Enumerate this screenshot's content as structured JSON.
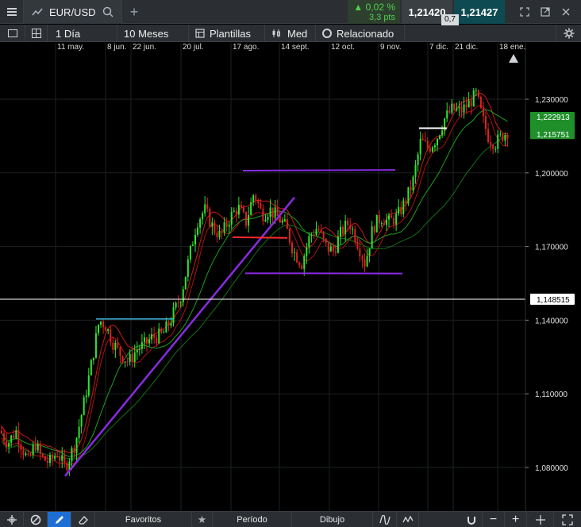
{
  "topbar": {
    "symbol": "EUR/USD",
    "add_tab": "+",
    "change_pct": "▲ 0,02 %",
    "change_pts": "3,3 pts",
    "bid": "1,21420",
    "ask": "1,21427",
    "spread": "0,7"
  },
  "toolbar": {
    "interval": "1 Día",
    "range": "10 Meses",
    "templates": "Plantillas",
    "style": "Med",
    "related": "Relacionado"
  },
  "chart_data": {
    "type": "candlestick",
    "symbol": "EUR/USD",
    "x_tick_labels": [
      "11 may.",
      "8 jun.",
      "22 jun.",
      "20 jul.",
      "17 ago.",
      "14 sept.",
      "12 oct.",
      "9 nov.",
      "7 dic.",
      "21 dic.",
      "18 ene."
    ],
    "y_tick_labels": [
      "1,230000",
      "1,200000",
      "1,170000",
      "1,140000",
      "1,110000",
      "1,080000"
    ],
    "y_ticks": [
      1.23,
      1.2,
      1.17,
      1.14,
      1.11,
      1.08
    ],
    "ylim": [
      1.0695,
      1.2635
    ],
    "price_tags": {
      "upper": "1,222913",
      "lower": "1,215751",
      "horizontal_line": "1,148515"
    },
    "horizontal_line_value": 1.148515,
    "colors": {
      "up": "#2fe52f",
      "down": "#e02020",
      "tag_green": "#1f8f2a",
      "purple": "#8a2be2",
      "trend_red": "#ff2a2a",
      "cyan": "#3fb0d8"
    }
  },
  "bottombar": {
    "favorites": "Favoritos",
    "period": "Período",
    "drawing": "Dibujo"
  }
}
